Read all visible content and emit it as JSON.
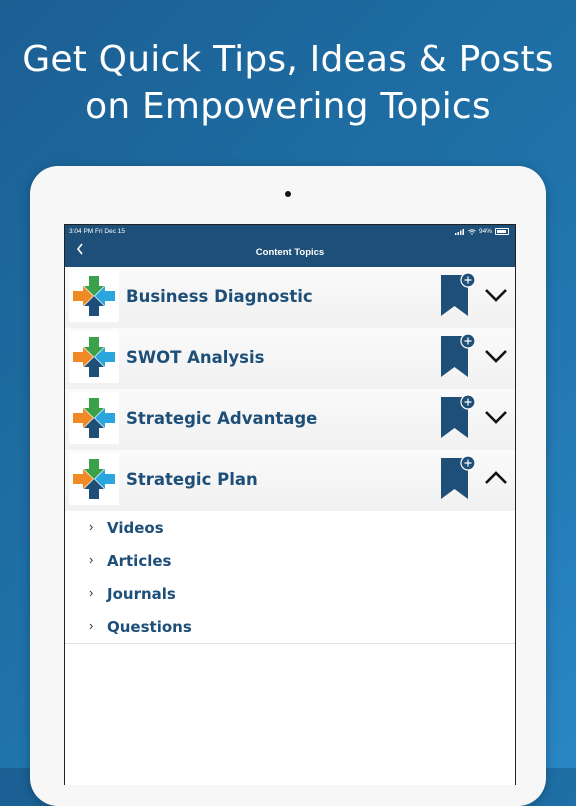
{
  "headline": {
    "line1": "Get Quick Tips, Ideas & Posts",
    "line2": "on Empowering Topics"
  },
  "status_bar": {
    "time_date": "3:04 PM   Fri Dec 15",
    "battery": "94%"
  },
  "nav": {
    "back_icon": "chevron-left-icon",
    "title": "Content Topics"
  },
  "topics": [
    {
      "title": "Business Diagnostic",
      "expanded": false
    },
    {
      "title": "SWOT Analysis",
      "expanded": false
    },
    {
      "title": "Strategic Advantage",
      "expanded": false
    },
    {
      "title": "Strategic Plan",
      "expanded": true
    }
  ],
  "sub_items": [
    {
      "label": "Videos"
    },
    {
      "label": "Articles"
    },
    {
      "label": "Journals"
    },
    {
      "label": "Questions"
    }
  ],
  "colors": {
    "brand_navy": "#1d4f79",
    "arrow_green": "#3aa04a",
    "arrow_orange": "#f08a25",
    "arrow_sky": "#2aa6de",
    "arrow_navy": "#1d4f79",
    "background_blue": "#1f6fa8"
  },
  "icons": [
    "logo-arrows-icon",
    "bookmark-add-icon",
    "chevron-down-icon",
    "chevron-up-icon",
    "chevron-right-icon"
  ]
}
